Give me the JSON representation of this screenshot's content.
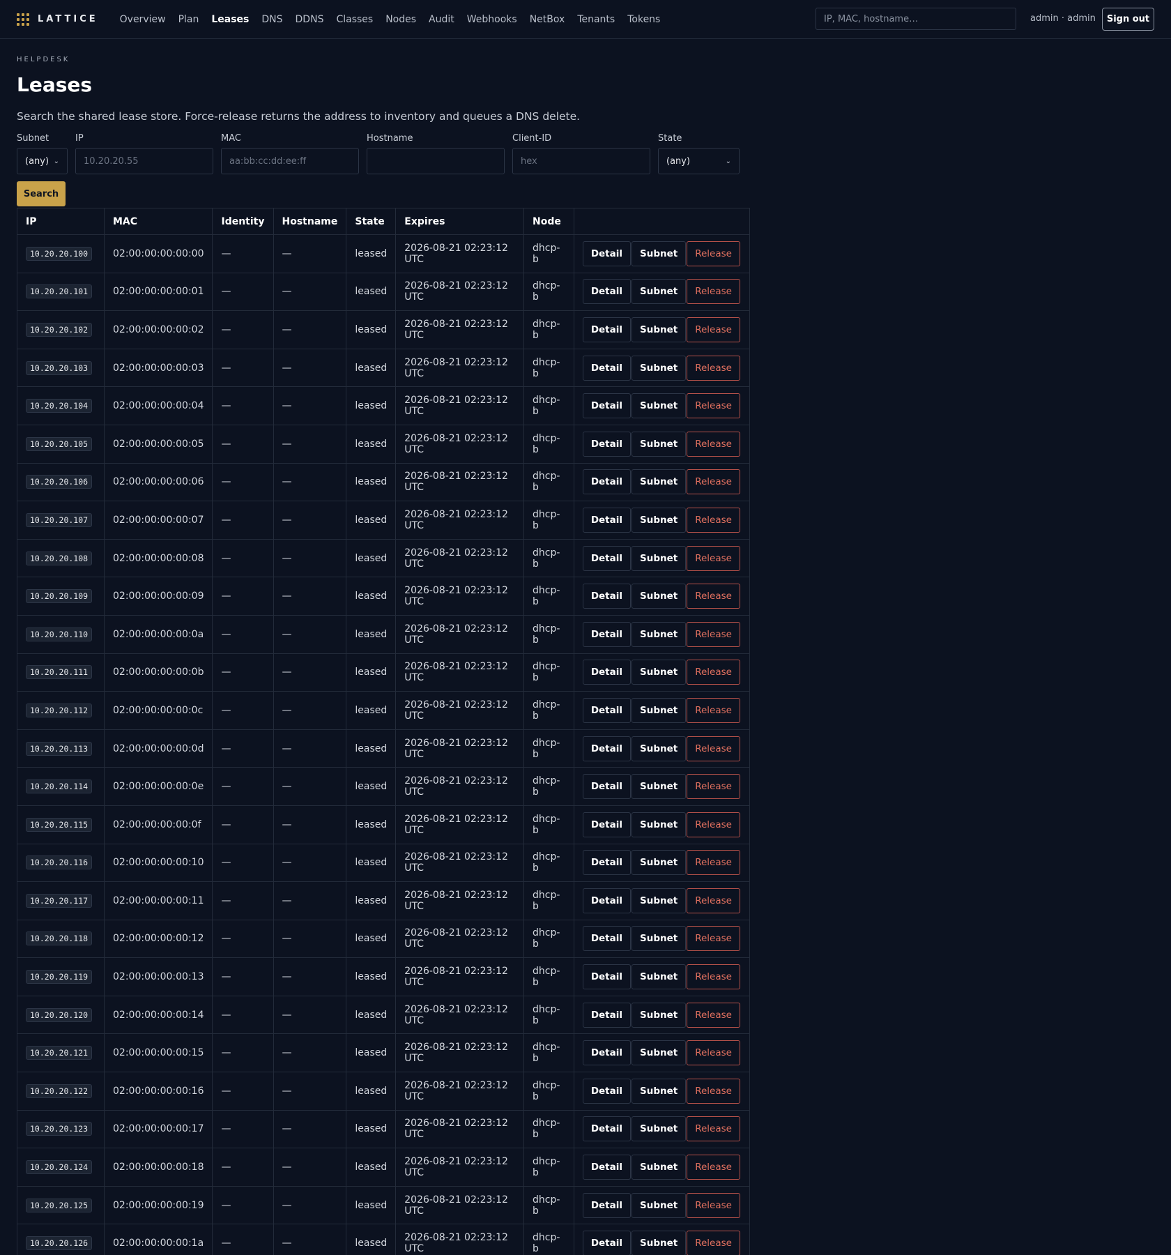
{
  "brand": "LATTICE",
  "nav": [
    "Overview",
    "Plan",
    "Leases",
    "DNS",
    "DDNS",
    "Classes",
    "Nodes",
    "Audit",
    "Webhooks",
    "NetBox",
    "Tenants",
    "Tokens"
  ],
  "active_nav": "Leases",
  "header": {
    "search_placeholder": "IP, MAC, hostname…",
    "user": "admin · admin",
    "signout_label": "Sign out"
  },
  "page": {
    "eyebrow": "HELPDESK",
    "title": "Leases",
    "description": "Search the shared lease store. Force-release returns the address to inventory and queues a DNS delete."
  },
  "filters": {
    "subnet": {
      "label": "Subnet",
      "value": "(any)"
    },
    "ip": {
      "label": "IP",
      "placeholder": "10.20.20.55"
    },
    "mac": {
      "label": "MAC",
      "placeholder": "aa:bb:cc:dd:ee:ff"
    },
    "hostname": {
      "label": "Hostname",
      "placeholder": ""
    },
    "client_id": {
      "label": "Client-ID",
      "placeholder": "hex"
    },
    "state": {
      "label": "State",
      "value": "(any)"
    },
    "search_label": "Search"
  },
  "table": {
    "columns": [
      "IP",
      "MAC",
      "Identity",
      "Hostname",
      "State",
      "Expires",
      "Node",
      ""
    ],
    "actions": {
      "detail": "Detail",
      "subnet": "Subnet",
      "release": "Release"
    },
    "rows": [
      {
        "ip": "10.20.20.100",
        "mac": "02:00:00:00:00:00",
        "identity": "—",
        "hostname": "—",
        "state": "leased",
        "expires": "2026-08-21 02:23:12 UTC",
        "node": "dhcp-b"
      },
      {
        "ip": "10.20.20.101",
        "mac": "02:00:00:00:00:01",
        "identity": "—",
        "hostname": "—",
        "state": "leased",
        "expires": "2026-08-21 02:23:12 UTC",
        "node": "dhcp-b"
      },
      {
        "ip": "10.20.20.102",
        "mac": "02:00:00:00:00:02",
        "identity": "—",
        "hostname": "—",
        "state": "leased",
        "expires": "2026-08-21 02:23:12 UTC",
        "node": "dhcp-b"
      },
      {
        "ip": "10.20.20.103",
        "mac": "02:00:00:00:00:03",
        "identity": "—",
        "hostname": "—",
        "state": "leased",
        "expires": "2026-08-21 02:23:12 UTC",
        "node": "dhcp-b"
      },
      {
        "ip": "10.20.20.104",
        "mac": "02:00:00:00:00:04",
        "identity": "—",
        "hostname": "—",
        "state": "leased",
        "expires": "2026-08-21 02:23:12 UTC",
        "node": "dhcp-b"
      },
      {
        "ip": "10.20.20.105",
        "mac": "02:00:00:00:00:05",
        "identity": "—",
        "hostname": "—",
        "state": "leased",
        "expires": "2026-08-21 02:23:12 UTC",
        "node": "dhcp-b"
      },
      {
        "ip": "10.20.20.106",
        "mac": "02:00:00:00:00:06",
        "identity": "—",
        "hostname": "—",
        "state": "leased",
        "expires": "2026-08-21 02:23:12 UTC",
        "node": "dhcp-b"
      },
      {
        "ip": "10.20.20.107",
        "mac": "02:00:00:00:00:07",
        "identity": "—",
        "hostname": "—",
        "state": "leased",
        "expires": "2026-08-21 02:23:12 UTC",
        "node": "dhcp-b"
      },
      {
        "ip": "10.20.20.108",
        "mac": "02:00:00:00:00:08",
        "identity": "—",
        "hostname": "—",
        "state": "leased",
        "expires": "2026-08-21 02:23:12 UTC",
        "node": "dhcp-b"
      },
      {
        "ip": "10.20.20.109",
        "mac": "02:00:00:00:00:09",
        "identity": "—",
        "hostname": "—",
        "state": "leased",
        "expires": "2026-08-21 02:23:12 UTC",
        "node": "dhcp-b"
      },
      {
        "ip": "10.20.20.110",
        "mac": "02:00:00:00:00:0a",
        "identity": "—",
        "hostname": "—",
        "state": "leased",
        "expires": "2026-08-21 02:23:12 UTC",
        "node": "dhcp-b"
      },
      {
        "ip": "10.20.20.111",
        "mac": "02:00:00:00:00:0b",
        "identity": "—",
        "hostname": "—",
        "state": "leased",
        "expires": "2026-08-21 02:23:12 UTC",
        "node": "dhcp-b"
      },
      {
        "ip": "10.20.20.112",
        "mac": "02:00:00:00:00:0c",
        "identity": "—",
        "hostname": "—",
        "state": "leased",
        "expires": "2026-08-21 02:23:12 UTC",
        "node": "dhcp-b"
      },
      {
        "ip": "10.20.20.113",
        "mac": "02:00:00:00:00:0d",
        "identity": "—",
        "hostname": "—",
        "state": "leased",
        "expires": "2026-08-21 02:23:12 UTC",
        "node": "dhcp-b"
      },
      {
        "ip": "10.20.20.114",
        "mac": "02:00:00:00:00:0e",
        "identity": "—",
        "hostname": "—",
        "state": "leased",
        "expires": "2026-08-21 02:23:12 UTC",
        "node": "dhcp-b"
      },
      {
        "ip": "10.20.20.115",
        "mac": "02:00:00:00:00:0f",
        "identity": "—",
        "hostname": "—",
        "state": "leased",
        "expires": "2026-08-21 02:23:12 UTC",
        "node": "dhcp-b"
      },
      {
        "ip": "10.20.20.116",
        "mac": "02:00:00:00:00:10",
        "identity": "—",
        "hostname": "—",
        "state": "leased",
        "expires": "2026-08-21 02:23:12 UTC",
        "node": "dhcp-b"
      },
      {
        "ip": "10.20.20.117",
        "mac": "02:00:00:00:00:11",
        "identity": "—",
        "hostname": "—",
        "state": "leased",
        "expires": "2026-08-21 02:23:12 UTC",
        "node": "dhcp-b"
      },
      {
        "ip": "10.20.20.118",
        "mac": "02:00:00:00:00:12",
        "identity": "—",
        "hostname": "—",
        "state": "leased",
        "expires": "2026-08-21 02:23:12 UTC",
        "node": "dhcp-b"
      },
      {
        "ip": "10.20.20.119",
        "mac": "02:00:00:00:00:13",
        "identity": "—",
        "hostname": "—",
        "state": "leased",
        "expires": "2026-08-21 02:23:12 UTC",
        "node": "dhcp-b"
      },
      {
        "ip": "10.20.20.120",
        "mac": "02:00:00:00:00:14",
        "identity": "—",
        "hostname": "—",
        "state": "leased",
        "expires": "2026-08-21 02:23:12 UTC",
        "node": "dhcp-b"
      },
      {
        "ip": "10.20.20.121",
        "mac": "02:00:00:00:00:15",
        "identity": "—",
        "hostname": "—",
        "state": "leased",
        "expires": "2026-08-21 02:23:12 UTC",
        "node": "dhcp-b"
      },
      {
        "ip": "10.20.20.122",
        "mac": "02:00:00:00:00:16",
        "identity": "—",
        "hostname": "—",
        "state": "leased",
        "expires": "2026-08-21 02:23:12 UTC",
        "node": "dhcp-b"
      },
      {
        "ip": "10.20.20.123",
        "mac": "02:00:00:00:00:17",
        "identity": "—",
        "hostname": "—",
        "state": "leased",
        "expires": "2026-08-21 02:23:12 UTC",
        "node": "dhcp-b"
      },
      {
        "ip": "10.20.20.124",
        "mac": "02:00:00:00:00:18",
        "identity": "—",
        "hostname": "—",
        "state": "leased",
        "expires": "2026-08-21 02:23:12 UTC",
        "node": "dhcp-b"
      },
      {
        "ip": "10.20.20.125",
        "mac": "02:00:00:00:00:19",
        "identity": "—",
        "hostname": "—",
        "state": "leased",
        "expires": "2026-08-21 02:23:12 UTC",
        "node": "dhcp-b"
      },
      {
        "ip": "10.20.20.126",
        "mac": "02:00:00:00:00:1a",
        "identity": "—",
        "hostname": "—",
        "state": "leased",
        "expires": "2026-08-21 02:23:12 UTC",
        "node": "dhcp-b"
      }
    ]
  },
  "colors": {
    "background": "#0c1220",
    "accent": "#c9a24a",
    "danger": "#e0705f"
  }
}
